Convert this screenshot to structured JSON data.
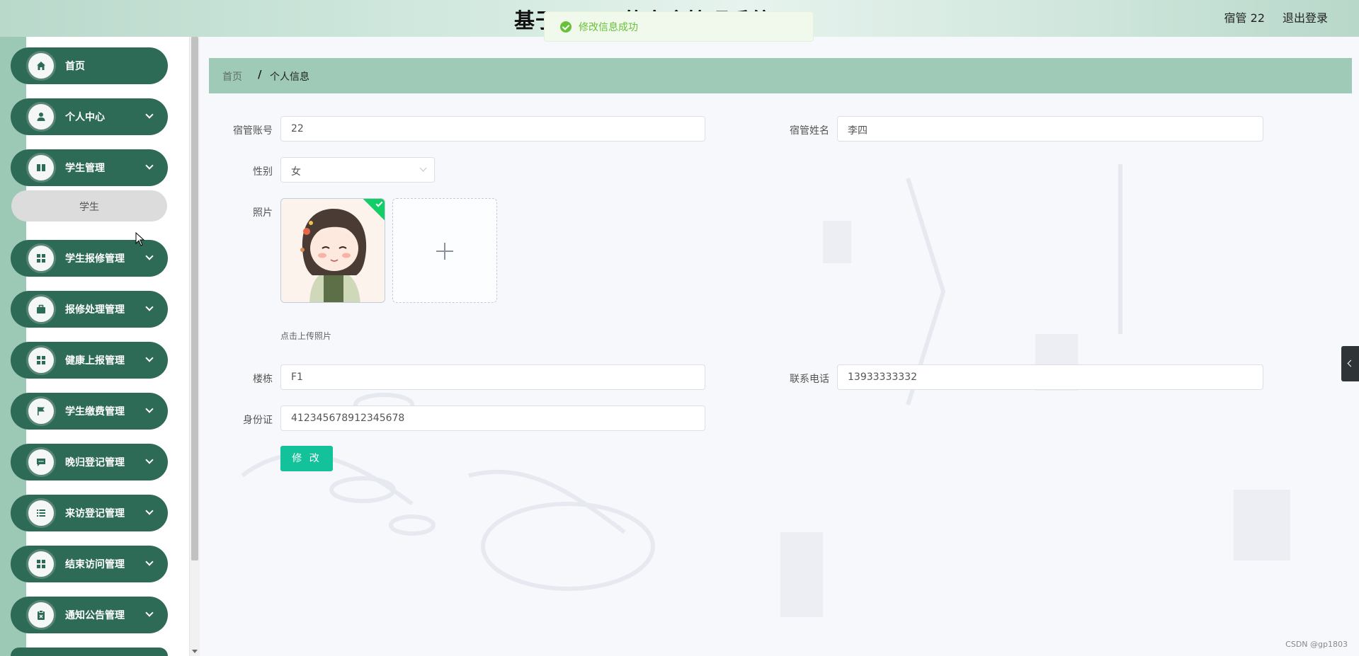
{
  "header": {
    "title": "基于    ······    的宿舍管理系统",
    "user": "宿管 22",
    "logout": "退出登录"
  },
  "toast": {
    "message": "修改信息成功"
  },
  "sidebar": {
    "items": [
      {
        "label": "首页",
        "icon": "home-icon"
      },
      {
        "label": "个人中心",
        "icon": "user-icon"
      },
      {
        "label": "学生管理",
        "icon": "book-icon"
      },
      {
        "label": "学生报修管理",
        "icon": "grid-icon"
      },
      {
        "label": "报修处理管理",
        "icon": "briefcase-icon"
      },
      {
        "label": "健康上报管理",
        "icon": "grid-icon"
      },
      {
        "label": "学生缴费管理",
        "icon": "flag-icon"
      },
      {
        "label": "晚归登记管理",
        "icon": "message-icon"
      },
      {
        "label": "来访登记管理",
        "icon": "list-icon"
      },
      {
        "label": "结束访问管理",
        "icon": "grid-icon"
      },
      {
        "label": "通知公告管理",
        "icon": "clipboard-icon"
      }
    ],
    "submenu": {
      "label": "学生"
    }
  },
  "breadcrumb": {
    "home": "首页",
    "separator": "/",
    "current": "个人信息"
  },
  "form": {
    "account": {
      "label": "宿管账号",
      "value": "22"
    },
    "name": {
      "label": "宿管姓名",
      "value": "李四"
    },
    "gender": {
      "label": "性别",
      "value": "女"
    },
    "photo": {
      "label": "照片",
      "tip": "点击上传照片"
    },
    "building": {
      "label": "楼栋",
      "value": "F1"
    },
    "phone": {
      "label": "联系电话",
      "value": "13933333332"
    },
    "idcard": {
      "label": "身份证",
      "value": "412345678912345678"
    },
    "submit": "修 改"
  },
  "footer": {
    "credit": "CSDN @gp1803"
  },
  "colors": {
    "menu": "#2e6b57",
    "breadcrumb": "#9fcab7",
    "submit": "#13c29b",
    "success": "#67c23a"
  }
}
